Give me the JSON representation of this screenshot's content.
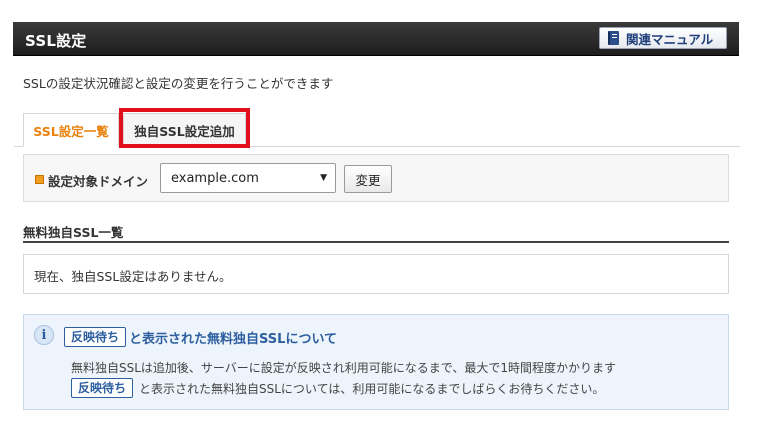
{
  "header": {
    "title": "SSL設定",
    "manual_button": {
      "label": "関連マニュアル",
      "icon": "book-icon"
    }
  },
  "intro": "SSLの設定状況確認と設定の変更を行うことができます",
  "tabs": [
    {
      "label": "SSL設定一覧",
      "active": true
    },
    {
      "label": "独自SSL設定追加",
      "active": false,
      "highlighted": true
    }
  ],
  "domain_selector": {
    "label": "設定対象ドメイン",
    "selected": "example.com",
    "button_label": "変更"
  },
  "free_ssl_list": {
    "title": "無料独自SSL一覧",
    "empty_message": "現在、独自SSL設定はありません。"
  },
  "info": {
    "icon_glyph": "i",
    "badge_label": "反映待ち",
    "heading": "と表示された無料独自SSLについて",
    "line1": "無料独自SSLは追加後、サーバーに設定が反映され利用可能になるまで、最大で1時間程度かかります",
    "line2": "と表示された無料独自SSLについては、利用可能になるまでしばらくお待ちください。"
  },
  "colors": {
    "header_bg": "#262626",
    "active_tab": "#e8820c",
    "highlight_border": "#e0101c",
    "info_accent": "#2d5fa0",
    "info_bg": "#eef4fb"
  }
}
